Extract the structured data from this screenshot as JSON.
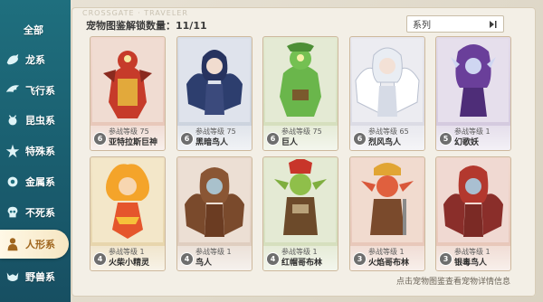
{
  "sidebar": {
    "categories": [
      {
        "label": "全部",
        "icon": "none"
      },
      {
        "label": "龙系",
        "icon": "dragon-icon"
      },
      {
        "label": "飞行系",
        "icon": "wing-icon"
      },
      {
        "label": "昆虫系",
        "icon": "insect-icon"
      },
      {
        "label": "特殊系",
        "icon": "star-icon"
      },
      {
        "label": "金属系",
        "icon": "gear-icon"
      },
      {
        "label": "不死系",
        "icon": "skull-icon"
      },
      {
        "label": "人形系",
        "icon": "humanoid-icon"
      },
      {
        "label": "野兽系",
        "icon": "beast-icon"
      }
    ],
    "active_index": 7,
    "accent_color": "#1f6f7e",
    "active_text_color": "#a0661e"
  },
  "header": {
    "watermark": "CROSSGATE · TRAVELER",
    "unlock_count": "宠物图鉴解锁数量：11/11",
    "filter_label": "系列"
  },
  "cards": [
    {
      "name": "亚特拉斯巨神",
      "level_text": "参战等级 75",
      "badge": "6",
      "frame": "red"
    },
    {
      "name": "黑暗鸟人",
      "level_text": "参战等级 75",
      "badge": "6",
      "frame": "blue"
    },
    {
      "name": "巨人",
      "level_text": "参战等级 75",
      "badge": "6",
      "frame": "green"
    },
    {
      "name": "烈风鸟人",
      "level_text": "参战等级 65",
      "badge": "6",
      "frame": "white"
    },
    {
      "name": "幻歌妖",
      "level_text": "参战等级 1",
      "badge": "5",
      "frame": "purple"
    },
    {
      "name": "火柴小精灵",
      "level_text": "参战等级 1",
      "badge": "4",
      "frame": "gold"
    },
    {
      "name": "鸟人",
      "level_text": "参战等级 1",
      "badge": "4",
      "frame": "brown"
    },
    {
      "name": "红帽哥布林",
      "level_text": "参战等级 1",
      "badge": "4",
      "frame": "green"
    },
    {
      "name": "火焰哥布林",
      "level_text": "参战等级 1",
      "badge": "3",
      "frame": "red"
    },
    {
      "name": "银毒鸟人",
      "level_text": "参战等级 1",
      "badge": "3",
      "frame": "red"
    }
  ],
  "footer": {
    "hint": "点击宠物图鉴查看宠物详情信息"
  }
}
